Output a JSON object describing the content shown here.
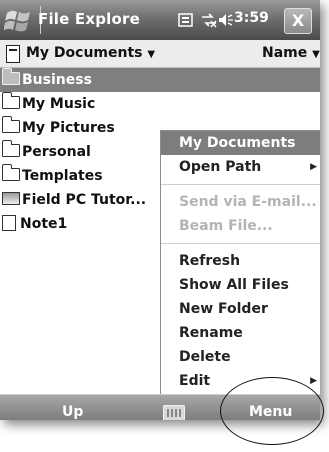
{
  "titlebar": {
    "title": "File Explore",
    "status_icons": [
      "tile-icon",
      "connectivity-icon",
      "speaker-icon"
    ],
    "time": "3:59",
    "close_label": "X"
  },
  "navbar": {
    "folder": "My Documents",
    "sort": "Name"
  },
  "files": [
    {
      "name": "Business",
      "icon": "folder-icon",
      "selected": true
    },
    {
      "name": "My Music",
      "icon": "folder-icon"
    },
    {
      "name": "My Pictures",
      "icon": "folder-icon"
    },
    {
      "name": "Personal",
      "icon": "folder-icon"
    },
    {
      "name": "Templates",
      "icon": "folder-icon"
    },
    {
      "name": "Field PC Tutor...",
      "icon": "program-icon"
    },
    {
      "name": "Note1",
      "icon": "note-icon"
    }
  ],
  "menu": {
    "header": "My Documents",
    "items": [
      {
        "label": "Open Path",
        "submenu": true
      },
      {
        "label": "Send via E-mail...",
        "disabled": true
      },
      {
        "label": "Beam File...",
        "disabled": true
      },
      {
        "label": "Refresh"
      },
      {
        "label": "Show All Files"
      },
      {
        "label": "New Folder"
      },
      {
        "label": "Rename"
      },
      {
        "label": "Delete"
      },
      {
        "label": "Edit",
        "submenu": true
      }
    ]
  },
  "softkeys": {
    "left": "Up",
    "right": "Menu"
  }
}
